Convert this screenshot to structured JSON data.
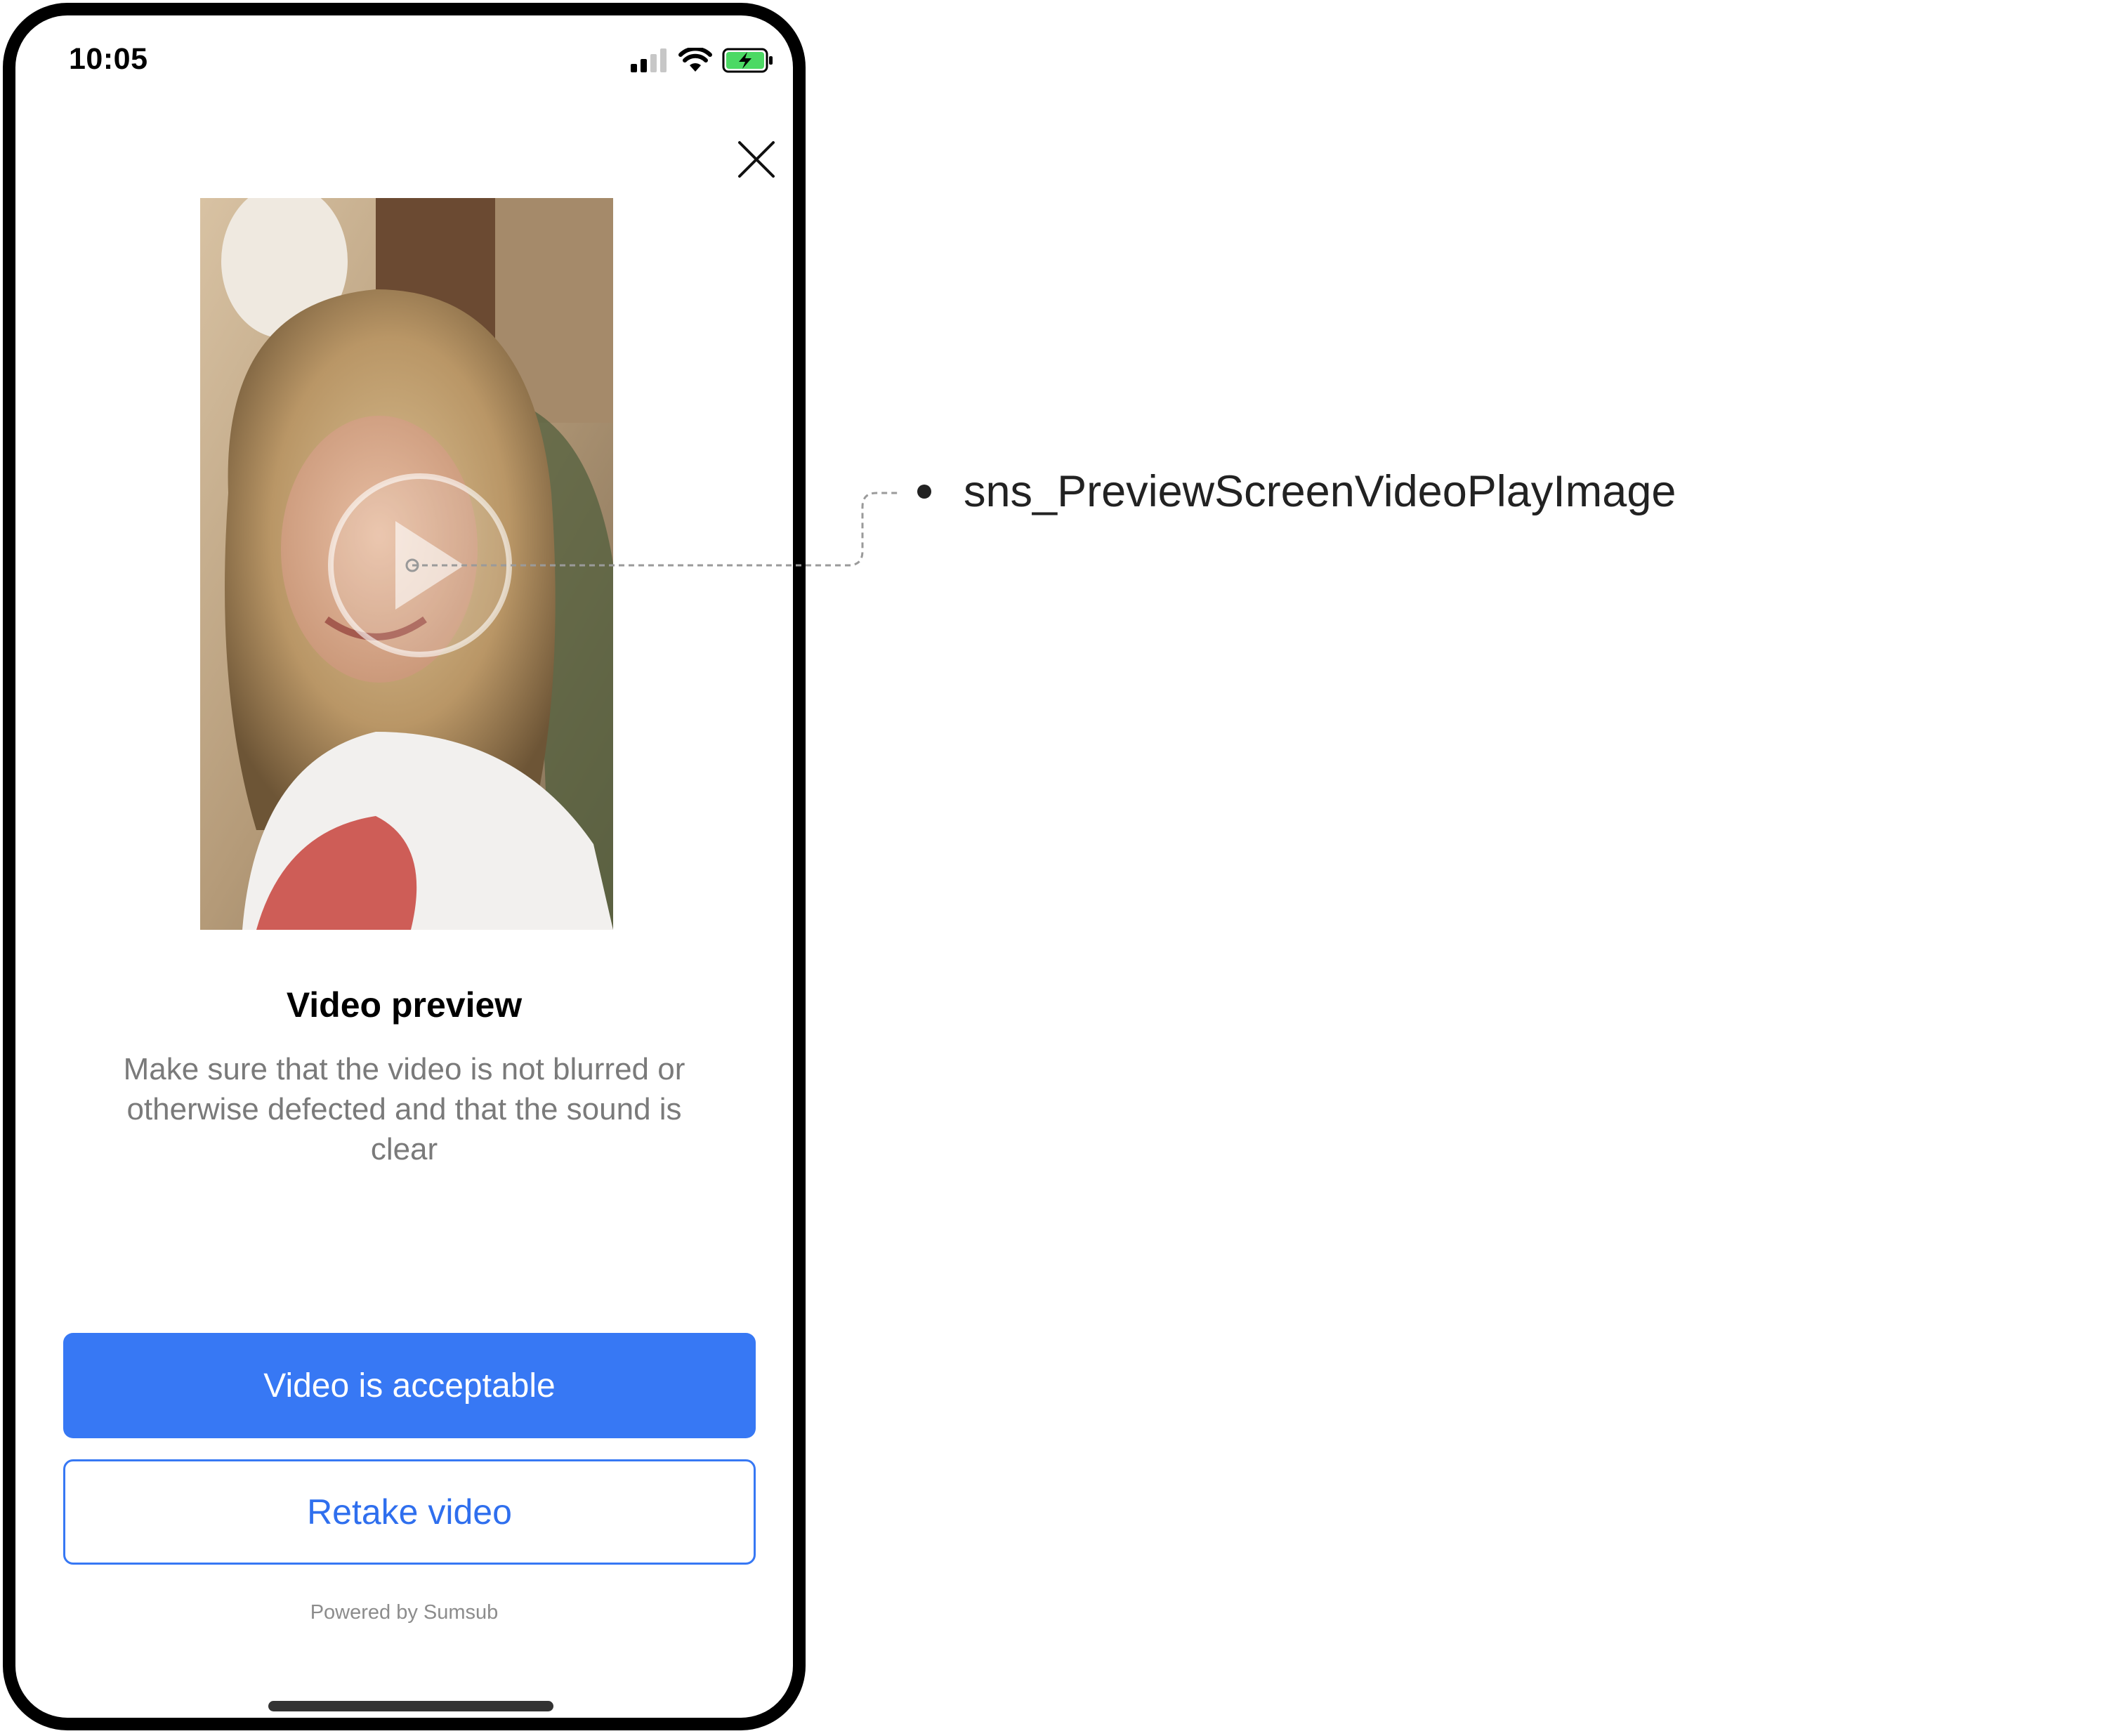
{
  "status_bar": {
    "time": "10:05",
    "signal_icon": "cellular-signal-icon",
    "wifi_icon": "wifi-icon",
    "battery_icon": "battery-charging-icon"
  },
  "header": {
    "close_icon": "close-icon"
  },
  "preview": {
    "play_icon": "play-circle-icon"
  },
  "content": {
    "title": "Video preview",
    "subtitle": "Make sure that the video is not blurred or otherwise defected and that the sound is clear"
  },
  "actions": {
    "primary_label": "Video is acceptable",
    "secondary_label": "Retake video"
  },
  "footer": {
    "powered_by": "Powered by Sumsub"
  },
  "annotation": {
    "label": "sns_PreviewScreenVideoPlayImage"
  },
  "colors": {
    "accent": "#3778f4",
    "battery_green": "#4cd964",
    "subtitle_gray": "#7a7a7a"
  }
}
